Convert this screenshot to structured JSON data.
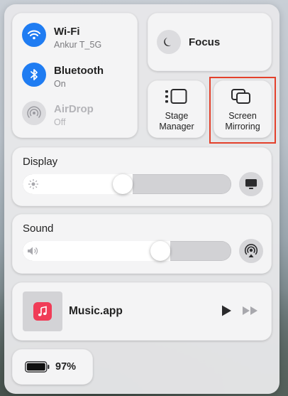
{
  "connectivity": {
    "wifi": {
      "label": "Wi-Fi",
      "status": "Ankur T_5G",
      "icon": "wifi-icon"
    },
    "bluetooth": {
      "label": "Bluetooth",
      "status": "On",
      "icon": "bluetooth-icon"
    },
    "airdrop": {
      "label": "AirDrop",
      "status": "Off",
      "icon": "airdrop-icon"
    }
  },
  "focus": {
    "label": "Focus",
    "icon": "moon-icon"
  },
  "stage_manager": {
    "line1": "Stage",
    "line2": "Manager",
    "icon": "stage-manager-icon"
  },
  "screen_mirroring": {
    "line1": "Screen",
    "line2": "Mirroring",
    "icon": "screen-mirroring-icon",
    "highlighted": true
  },
  "display": {
    "title": "Display",
    "level": 0.48,
    "icon": "display-settings-icon"
  },
  "sound": {
    "title": "Sound",
    "level": 0.66,
    "icon": "airplay-audio-icon"
  },
  "now_playing": {
    "app": "Music.app",
    "icon": "music-app-icon"
  },
  "battery": {
    "percent": "97%",
    "icon": "battery-icon"
  },
  "colors": {
    "accent": "#1f7cf2",
    "highlight": "#e3402b",
    "music": "#f03c57"
  }
}
